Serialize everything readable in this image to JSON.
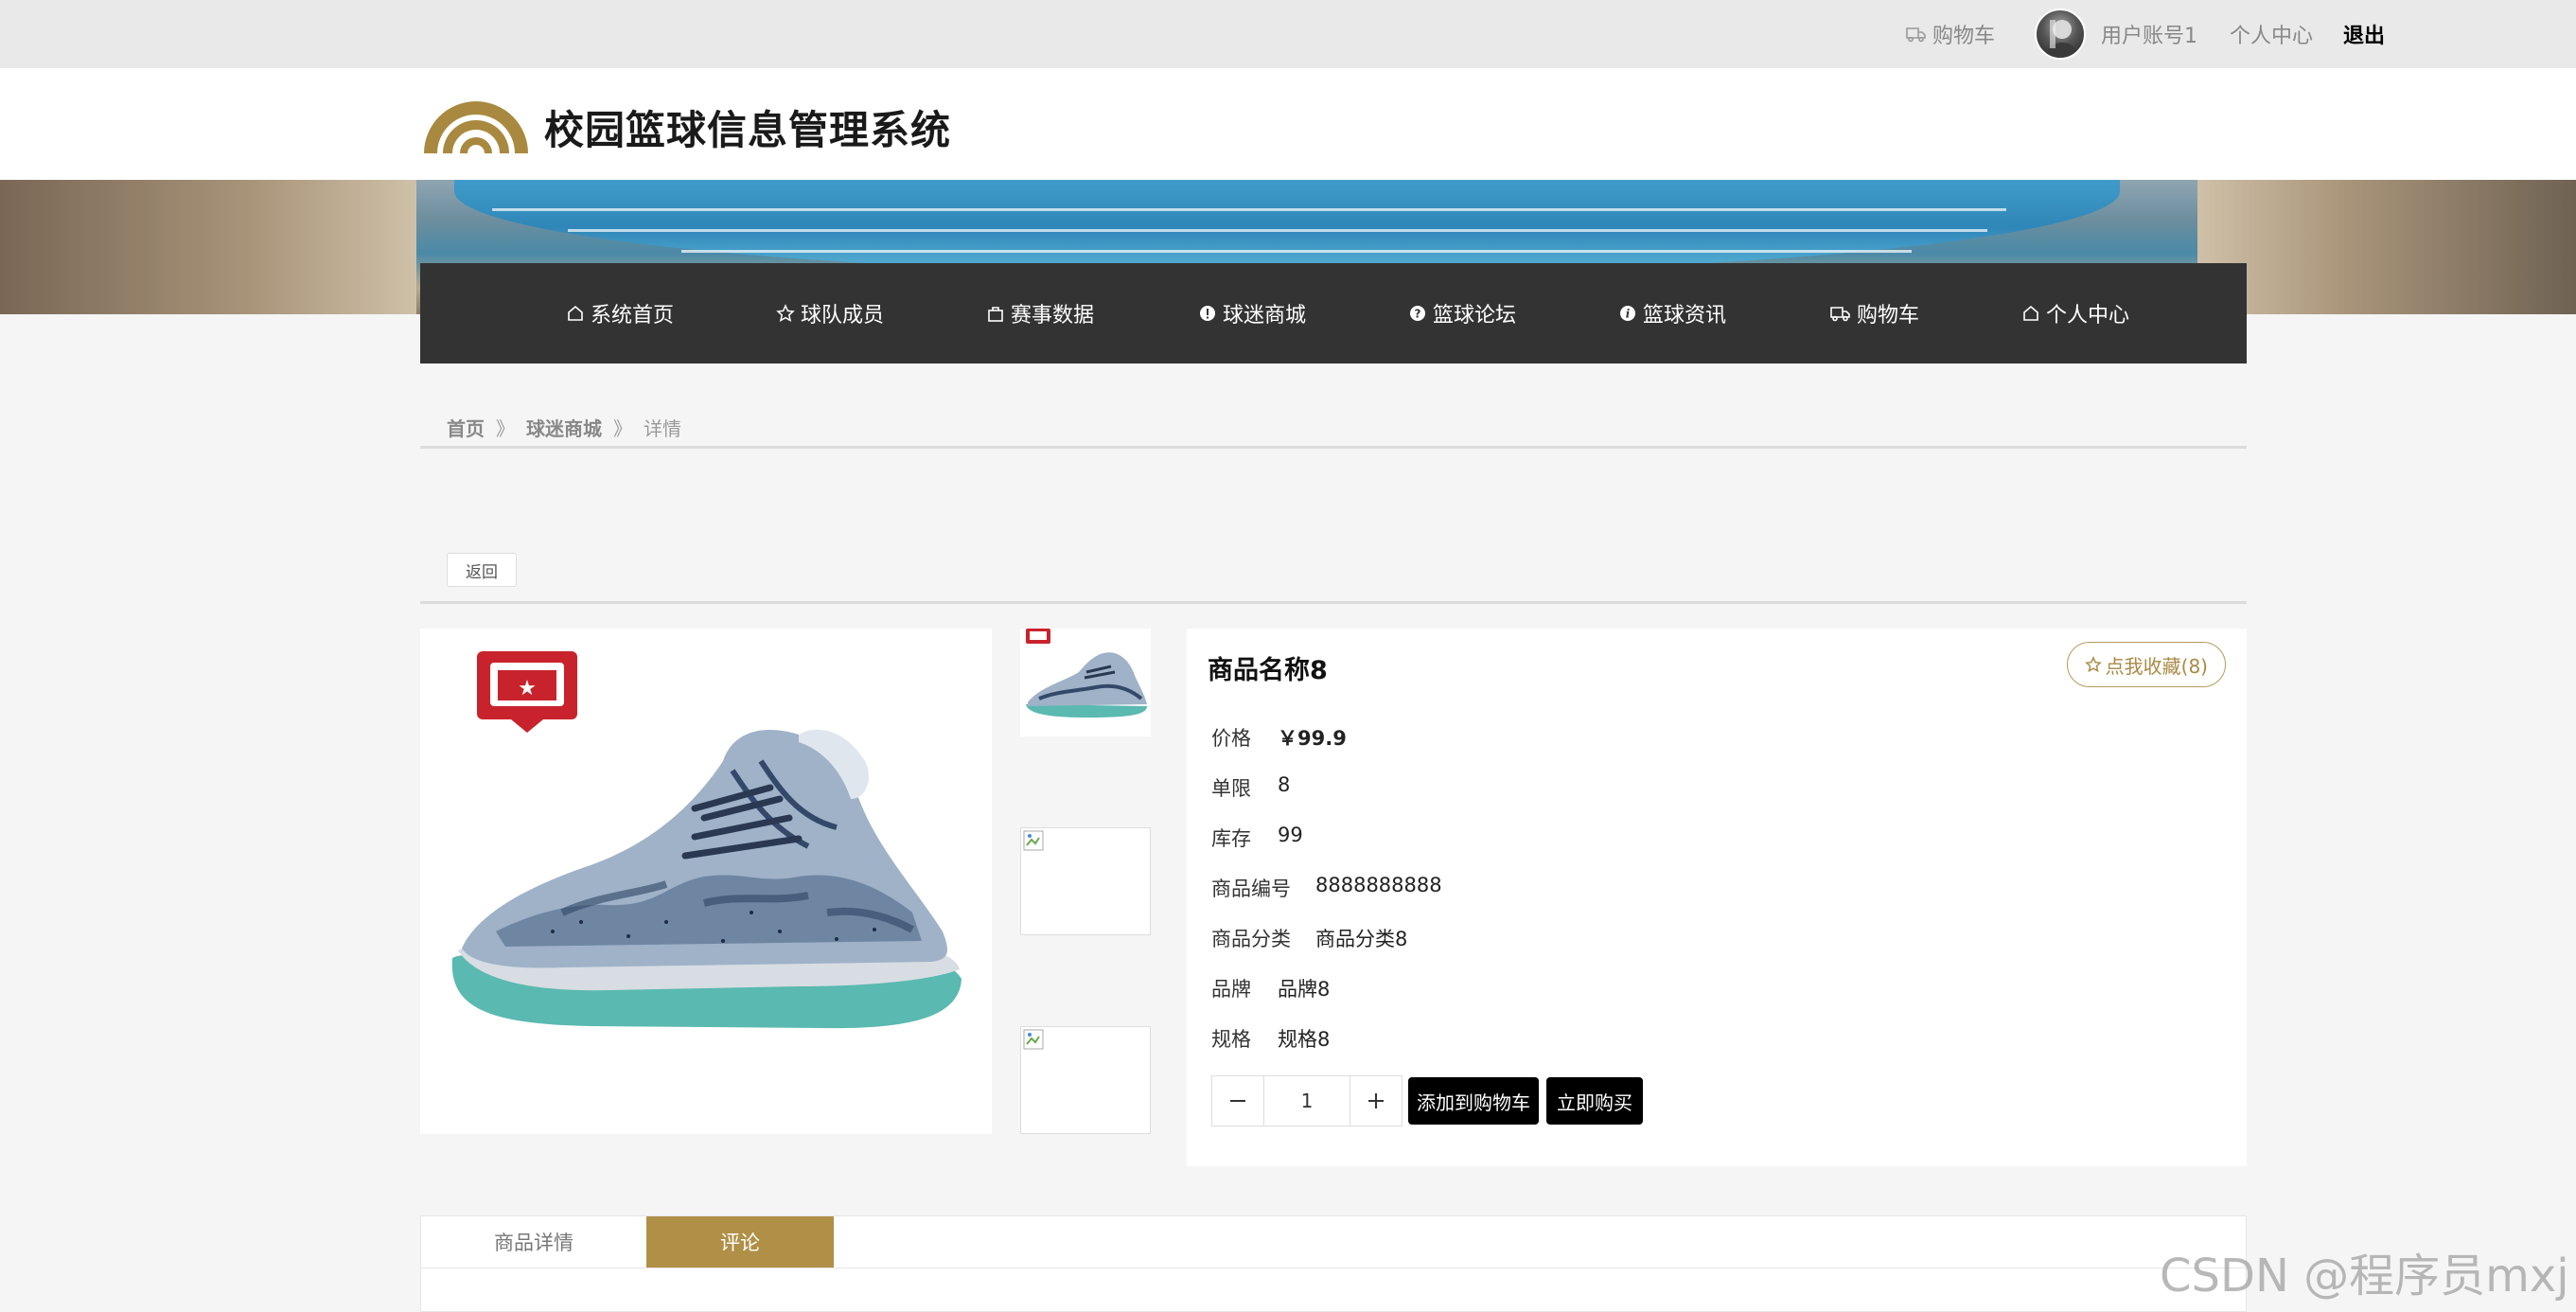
{
  "topbar": {
    "cart_label": "购物车",
    "account_label": "用户账号1",
    "user_center_label": "个人中心",
    "logout_label": "退出"
  },
  "header": {
    "site_title": "校园篮球信息管理系统",
    "brand_color": "#b08f46"
  },
  "nav": {
    "items": [
      {
        "label": "系统首页",
        "icon": "home-icon"
      },
      {
        "label": "球队成员",
        "icon": "star-icon"
      },
      {
        "label": "赛事数据",
        "icon": "bag-icon"
      },
      {
        "label": "球迷商城",
        "icon": "exclamation-icon"
      },
      {
        "label": "篮球论坛",
        "icon": "question-icon"
      },
      {
        "label": "篮球资讯",
        "icon": "info-icon"
      },
      {
        "label": "购物车",
        "icon": "truck-icon"
      },
      {
        "label": "个人中心",
        "icon": "home-icon"
      }
    ]
  },
  "breadcrumb": {
    "home": "首页",
    "sep": "》",
    "mall": "球迷商城",
    "current": "详情"
  },
  "back_label": "返回",
  "product": {
    "name": "商品名称8",
    "favorite_label": "点我收藏(8)",
    "fields": [
      {
        "label": "价格",
        "value": "￥99.9"
      },
      {
        "label": "单限",
        "value": "8"
      },
      {
        "label": "库存",
        "value": "99"
      },
      {
        "label": "商品编号",
        "value": "8888888888"
      },
      {
        "label": "商品分类",
        "value": "商品分类8"
      },
      {
        "label": "品牌",
        "value": "品牌8"
      },
      {
        "label": "规格",
        "value": "规格8"
      }
    ],
    "quantity": "1",
    "add_to_cart_label": "添加到购物车",
    "buy_now_label": "立即购买"
  },
  "tabs": [
    {
      "label": "商品详情",
      "active": false
    },
    {
      "label": "评论",
      "active": true
    }
  ],
  "watermark": "CSDN @程序员mxj"
}
